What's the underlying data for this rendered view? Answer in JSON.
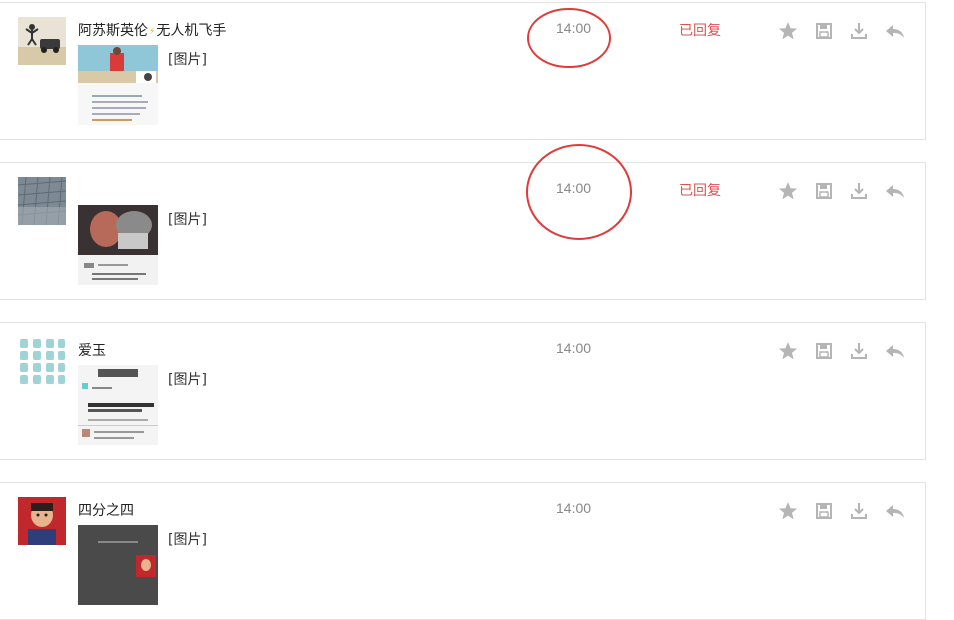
{
  "messages": [
    {
      "sender": "阿苏斯英伦",
      "sender_suffix": "无人机飞手",
      "has_badge": true,
      "badge_icon": "lightning-icon",
      "preview": "[图片]",
      "time": "14:00",
      "status": "已回复",
      "annotated_time": true
    },
    {
      "sender": "",
      "sender_suffix": "",
      "has_badge": false,
      "preview": "[图片]",
      "time": "14:00",
      "status": "已回复",
      "annotated_time": true
    },
    {
      "sender": "爱玉",
      "sender_suffix": "",
      "has_badge": false,
      "preview": "[图片]",
      "time": "14:00",
      "status": "",
      "annotated_time": false
    },
    {
      "sender": "四分之四",
      "sender_suffix": "",
      "has_badge": false,
      "preview": "[图片]",
      "time": "14:00",
      "status": "",
      "annotated_time": false
    }
  ],
  "actions": {
    "star_icon": "star-icon",
    "save_icon": "save-icon",
    "download_icon": "download-icon",
    "reply_icon": "reply-icon",
    "icon_color": "#b5b5b5"
  },
  "colors": {
    "status": "#d9534f",
    "time": "#888888",
    "annotation": "#e03a3a",
    "border": "#e3e3e3"
  }
}
